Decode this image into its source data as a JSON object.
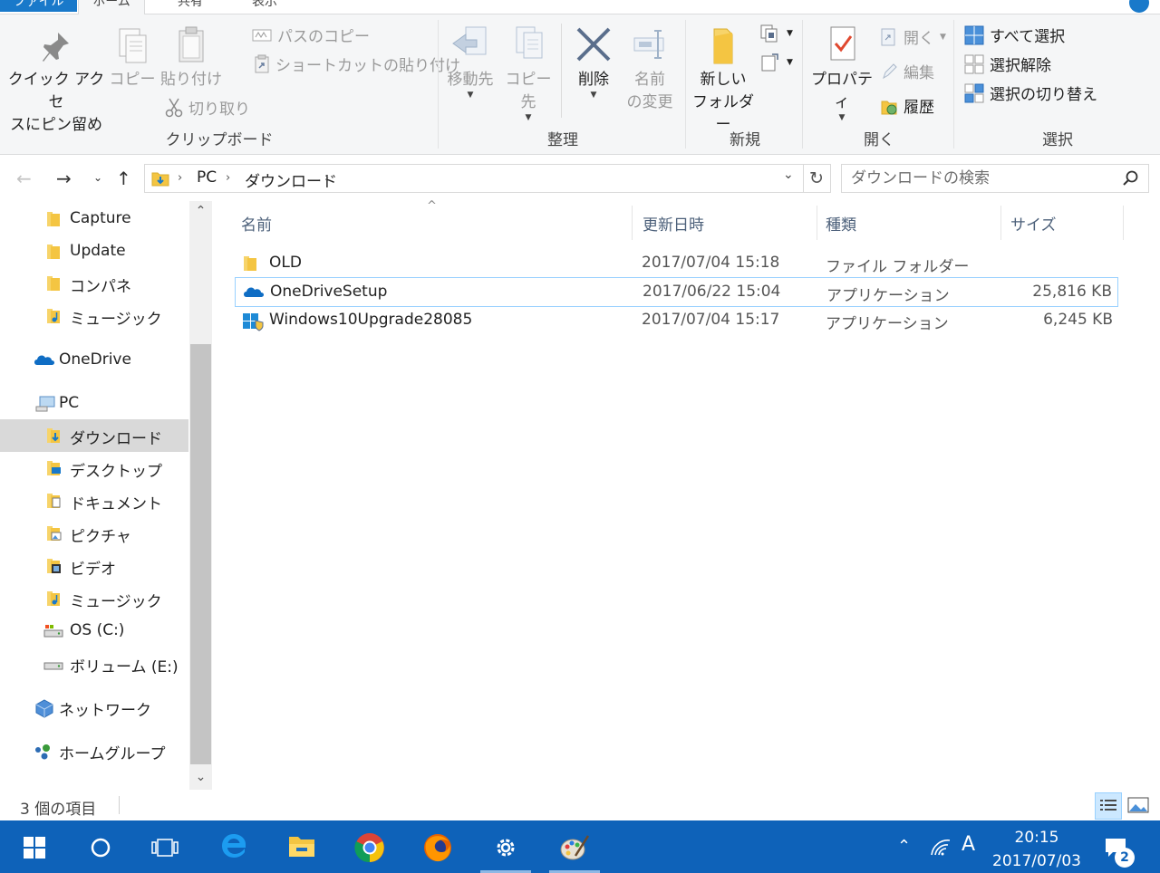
{
  "ribbon": {
    "tabs": [
      "ファイル",
      "ホーム",
      "共有",
      "表示"
    ],
    "clipboard": {
      "pin_label_1": "クイック アクセ",
      "pin_label_2": "スにピン留め",
      "copy_label": "コピー",
      "paste_label": "貼り付け",
      "copy_path_label": "パスのコピー",
      "paste_shortcut_label": "ショートカットの貼り付け",
      "cut_label": "切り取り",
      "group_label": "クリップボード"
    },
    "organize": {
      "move_to_label": "移動先",
      "copy_to_label": "コピー先",
      "delete_label": "削除",
      "rename_label_1": "名前",
      "rename_label_2": "の変更",
      "group_label": "整理"
    },
    "new": {
      "new_folder_label_1": "新しい",
      "new_folder_label_2": "フォルダー",
      "group_label": "新規"
    },
    "open": {
      "properties_label": "プロパティ",
      "open_label": "開く",
      "edit_label": "編集",
      "history_label": "履歴",
      "group_label": "開く"
    },
    "select": {
      "select_all_label": "すべて選択",
      "select_none_label": "選択解除",
      "invert_label": "選択の切り替え",
      "group_label": "選択"
    }
  },
  "address": {
    "crumbs": [
      "PC",
      "ダウンロード"
    ],
    "search_placeholder": "ダウンロードの検索"
  },
  "nav": {
    "items": [
      {
        "label": "Capture",
        "icon": "folder-icon"
      },
      {
        "label": "Update",
        "icon": "folder-icon"
      },
      {
        "label": "コンパネ",
        "icon": "folder-icon"
      },
      {
        "label": "ミュージック",
        "icon": "music-folder-icon"
      },
      {
        "label": "OneDrive",
        "icon": "onedrive-icon"
      },
      {
        "label": "PC",
        "icon": "pc-icon"
      },
      {
        "label": "ダウンロード",
        "icon": "downloads-folder-icon"
      },
      {
        "label": "デスクトップ",
        "icon": "desktop-folder-icon"
      },
      {
        "label": "ドキュメント",
        "icon": "documents-folder-icon"
      },
      {
        "label": "ピクチャ",
        "icon": "pictures-folder-icon"
      },
      {
        "label": "ビデオ",
        "icon": "videos-folder-icon"
      },
      {
        "label": "ミュージック",
        "icon": "music-folder-icon"
      },
      {
        "label": "OS (C:)",
        "icon": "drive-c-icon"
      },
      {
        "label": "ボリューム (E:)",
        "icon": "drive-e-icon"
      },
      {
        "label": "ネットワーク",
        "icon": "network-icon"
      },
      {
        "label": "ホームグループ",
        "icon": "homegroup-icon"
      }
    ],
    "selected": "ダウンロード"
  },
  "files": {
    "columns": {
      "name": "名前",
      "date": "更新日時",
      "type": "種類",
      "size": "サイズ"
    },
    "rows": [
      {
        "name": "OLD",
        "date": "2017/07/04 15:18",
        "type": "ファイル フォルダー",
        "size": "",
        "icon": "folder-icon"
      },
      {
        "name": "OneDriveSetup",
        "date": "2017/06/22 15:04",
        "type": "アプリケーション",
        "size": "25,816 KB",
        "icon": "onedrive-icon"
      },
      {
        "name": "Windows10Upgrade28085",
        "date": "2017/07/04 15:17",
        "type": "アプリケーション",
        "size": "6,245 KB",
        "icon": "windows-shield-icon"
      }
    ],
    "selected_row": "OneDriveSetup"
  },
  "status": {
    "item_count": "3 個の項目"
  },
  "taskbar": {
    "time": "20:15",
    "date": "2017/07/03",
    "ime_indicator": "A",
    "notification_count": "2",
    "pinned": [
      "start-icon",
      "cortana-icon",
      "task-view-icon",
      "edge-icon",
      "file-explorer-icon",
      "chrome-icon",
      "firefox-icon",
      "settings-icon",
      "paint-icon"
    ]
  },
  "colors": {
    "accent": "#1979ca",
    "taskbar": "#0e62b9",
    "ribbon_bg": "#f5f6f7",
    "selection_border": "#99d1ff",
    "folder": "#f4c542"
  }
}
